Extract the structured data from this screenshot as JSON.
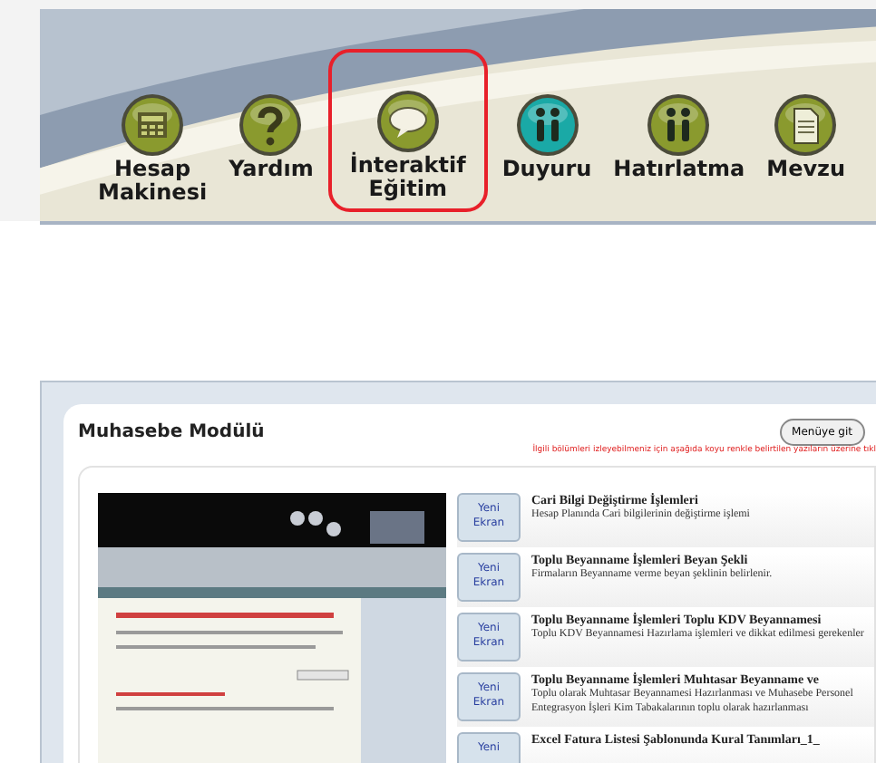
{
  "toolbar": {
    "items": [
      {
        "label": "Hesap Makinesi",
        "color": "#8a9a2e",
        "highlighted": false
      },
      {
        "label": "Yardım",
        "color": "#8a9a2e",
        "highlighted": false
      },
      {
        "label": "İnteraktif Eğitim",
        "color": "#8a9a2e",
        "highlighted": true
      },
      {
        "label": "Duyuru",
        "color": "#1aa9a6",
        "highlighted": false
      },
      {
        "label": "Hatırlatma",
        "color": "#8a9a2e",
        "highlighted": false
      },
      {
        "label": "Mevzu",
        "color": "#8a9a2e",
        "highlighted": false
      }
    ]
  },
  "module": {
    "title": "Muhasebe Modülü",
    "menu_button": "Menüye git",
    "notice": "İlgili bölümleri izleyebilmeniz için aşağıda koyu renkle belirtilen yazıların üzerine tıkl",
    "lessons": [
      {
        "button": "Yeni Ekran",
        "title": "Cari Bilgi Değiştirme İşlemleri",
        "description": "Hesap Planında Cari bilgilerinin değiştirme işlemi"
      },
      {
        "button": "Yeni Ekran",
        "title": "Toplu Beyanname İşlemleri Beyan Şekli",
        "description": "Firmaların Beyanname verme beyan şeklinin belirlenir."
      },
      {
        "button": "Yeni Ekran",
        "title": "Toplu Beyanname İşlemleri Toplu KDV Beyannamesi",
        "description": "Toplu KDV Beyannamesi Hazırlama işlemleri ve dikkat edilmesi gerekenler"
      },
      {
        "button": "Yeni Ekran",
        "title": "Toplu Beyanname İşlemleri Muhtasar Beyanname ve",
        "description": "Toplu olarak Muhtasar Beyannamesi Hazırlanması ve Muhasebe Personel Entegrasyon İşleri Kim Tabakalarının toplu olarak hazırlanması"
      },
      {
        "button": "Yeni",
        "title": "Excel Fatura Listesi Şablonunda Kural Tanımları_1_"
      }
    ]
  }
}
